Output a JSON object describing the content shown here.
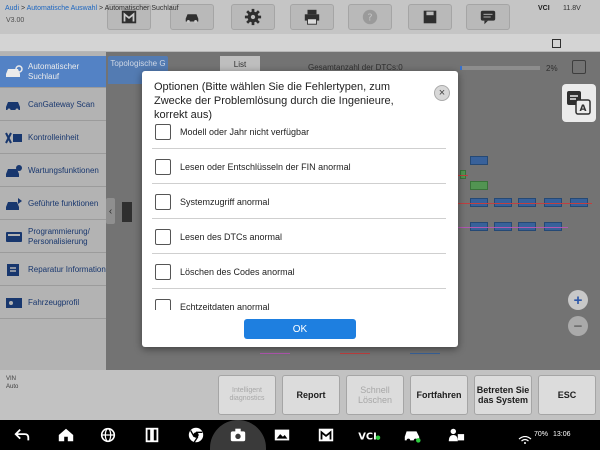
{
  "app": {
    "version": "V3.00"
  },
  "breadcrumb": {
    "root": "Audi",
    "sep1": " > ",
    "mid": "Automatische Auswahl",
    "sep2": " > ",
    "current": "Automatischer Suchlauf"
  },
  "status_right": {
    "vci": "VCI",
    "voltage": "11.8V"
  },
  "sidebar": {
    "items": [
      {
        "label": "Automatischer Suchlauf",
        "icon": "car-scan-icon",
        "active": true
      },
      {
        "label": "CanGateway Scan",
        "icon": "car-gateway-icon"
      },
      {
        "label": "Kontrolleinheit",
        "icon": "control-unit-icon"
      },
      {
        "label": "Wartungsfunktionen",
        "icon": "service-icon"
      },
      {
        "label": "Geführte funktionen",
        "icon": "guided-functions-icon"
      },
      {
        "label": "Programmierung/ Personalisierung",
        "icon": "programming-icon"
      },
      {
        "label": "Reparatur Information",
        "icon": "repair-info-icon"
      },
      {
        "label": "Fahrzeugprofil",
        "icon": "vehicle-profile-icon"
      }
    ]
  },
  "main": {
    "tab_topology": "Topologische G",
    "tab_list": "List",
    "dtc_total": "Gesamtanzahl der DTCs:0",
    "percent": "2%"
  },
  "dialog": {
    "title": "Optionen (Bitte wählen Sie die Fehlertypen, zum Zwecke der Problemlösung durch die Ingenieure, korrekt aus)",
    "options": [
      "Modell oder Jahr nicht verfügbar",
      "Lesen oder Entschlüsseln der FIN anormal",
      "Systemzugriff anormal",
      "Lesen des DTCs anormal",
      "Löschen des Codes anormal",
      "Echtzeitdaten anormal"
    ],
    "ok": "OK"
  },
  "bottom": {
    "vin": "VIN",
    "auto": "Auto",
    "buttons": {
      "intelligent": "Intelligent diagnostics",
      "report": "Report",
      "quick_erase": "Schnell Löschen",
      "continue": "Fortfahren",
      "enter_system": "Betreten Sie das System",
      "esc": "ESC"
    }
  },
  "statusbar": {
    "battery": "70%",
    "time": "13:06"
  },
  "colors": {
    "accent": "#1e7fe0",
    "sidebar_active": "#5b8ed6"
  }
}
